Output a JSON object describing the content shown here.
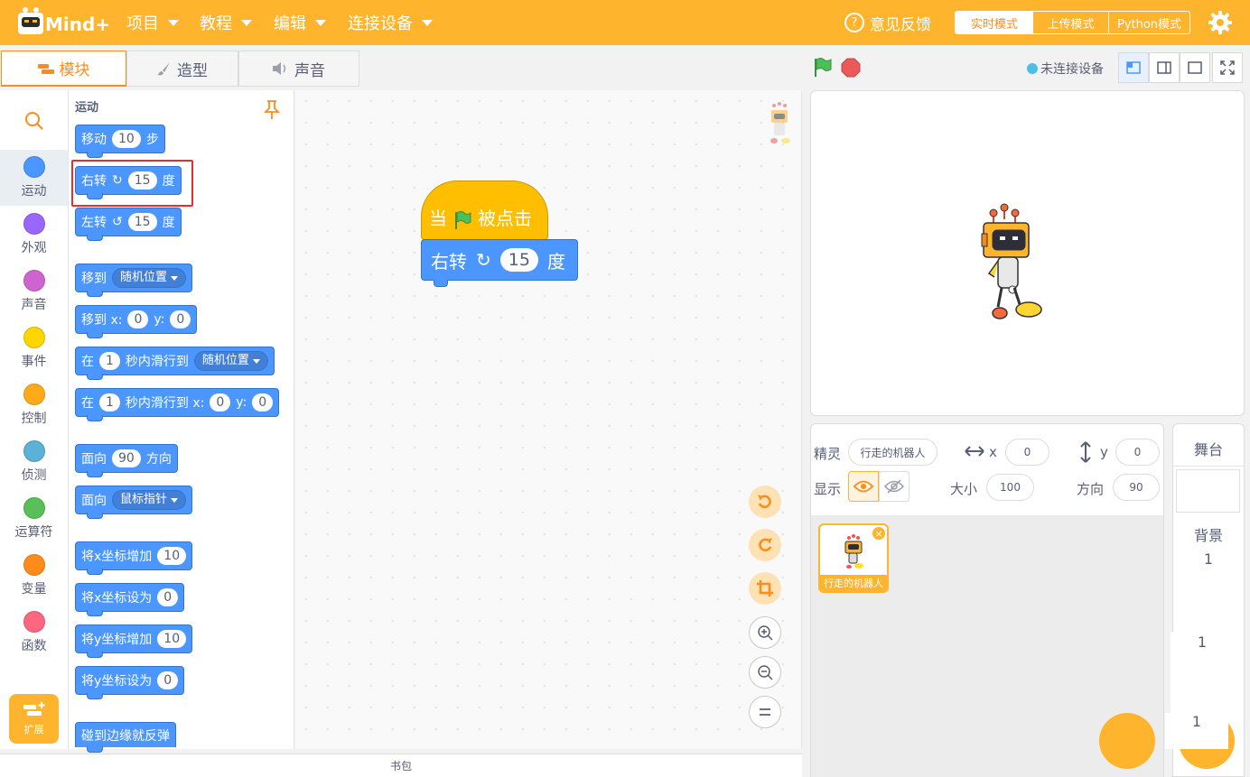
{
  "app": {
    "logo_text": "Mind+"
  },
  "menu": [
    {
      "label": "项目"
    },
    {
      "label": "教程"
    },
    {
      "label": "编辑"
    },
    {
      "label": "连接设备"
    }
  ],
  "header": {
    "feedback": "意见反馈",
    "modes": [
      "实时模式",
      "上传模式",
      "Python模式"
    ]
  },
  "tabs": [
    "模块",
    "造型",
    "声音"
  ],
  "categories": [
    "运动",
    "外观",
    "声音",
    "事件",
    "控制",
    "侦测",
    "运算符",
    "变量",
    "函数"
  ],
  "category_colors": [
    "#4c97ff",
    "#9966ff",
    "#cf63cf",
    "#ffd500",
    "#ffab19",
    "#5cb1d6",
    "#59c059",
    "#ff8c1a",
    "#ff6680"
  ],
  "extension_label": "扩展",
  "palette": {
    "title": "运动",
    "move": {
      "a": "移动",
      "v": "10",
      "b": "步"
    },
    "turn_right": {
      "a": "右转",
      "v": "15",
      "b": "度"
    },
    "turn_left": {
      "a": "左转",
      "v": "15",
      "b": "度"
    },
    "goto": {
      "a": "移到",
      "dd": "随机位置"
    },
    "goto_xy": {
      "a": "移到 x:",
      "x": "0",
      "b": "y:",
      "y": "0"
    },
    "glide": {
      "a": "在",
      "v": "1",
      "b": "秒内滑行到",
      "dd": "随机位置"
    },
    "glide_xy": {
      "a": "在",
      "v": "1",
      "b": "秒内滑行到 x:",
      "x": "0",
      "c": "y:",
      "y": "0"
    },
    "point_dir": {
      "a": "面向",
      "v": "90",
      "b": "方向"
    },
    "point_towards": {
      "a": "面向",
      "dd": "鼠标指针"
    },
    "change_x": {
      "a": "将x坐标增加",
      "v": "10"
    },
    "set_x": {
      "a": "将x坐标设为",
      "v": "0"
    },
    "change_y": {
      "a": "将y坐标增加",
      "v": "10"
    },
    "set_y": {
      "a": "将y坐标设为",
      "v": "0"
    },
    "bounce": "碰到边缘就反弹"
  },
  "script": {
    "hat": {
      "a": "当",
      "b": "被点击"
    },
    "turn": {
      "a": "右转",
      "v": "15",
      "b": "度"
    }
  },
  "backpack": "书包",
  "stage_header": {
    "connection": "未连接设备"
  },
  "sprite_info": {
    "sprite_label": "精灵",
    "sprite_name": "行走的机器人",
    "x_label": "x",
    "x": "0",
    "y_label": "y",
    "y": "0",
    "show_label": "显示",
    "size_label": "大小",
    "size": "100",
    "direction_label": "方向",
    "direction": "90"
  },
  "sprites": [
    {
      "name": "行走的机器人"
    }
  ],
  "stage_panel": {
    "title": "舞台",
    "backdrop_label": "背景",
    "backdrop_count": "1",
    "extra1": "1",
    "extra2": "1"
  },
  "colors": {
    "accent": "#ffb42d",
    "motion": "#4c97ff",
    "event": "#ffbf00"
  }
}
